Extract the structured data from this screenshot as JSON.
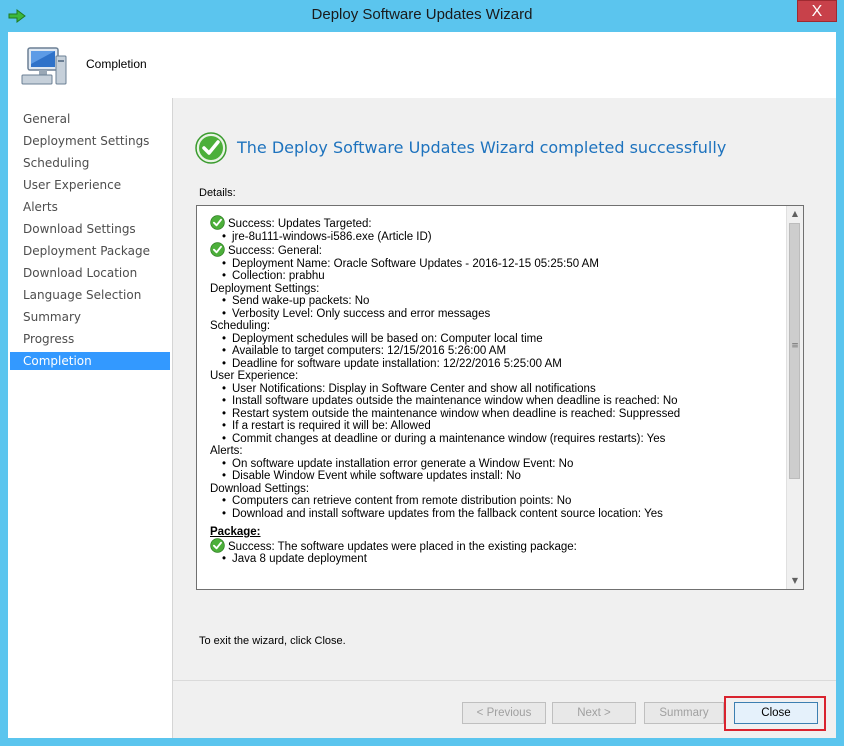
{
  "window": {
    "title": "Deploy Software Updates Wizard",
    "close_glyph": "X"
  },
  "header": {
    "title": "Completion"
  },
  "nav": {
    "items": [
      {
        "label": "General",
        "active": false
      },
      {
        "label": "Deployment Settings",
        "active": false
      },
      {
        "label": "Scheduling",
        "active": false
      },
      {
        "label": "User Experience",
        "active": false
      },
      {
        "label": "Alerts",
        "active": false
      },
      {
        "label": "Download Settings",
        "active": false
      },
      {
        "label": "Deployment Package",
        "active": false
      },
      {
        "label": "Download Location",
        "active": false
      },
      {
        "label": "Language Selection",
        "active": false
      },
      {
        "label": "Summary",
        "active": false
      },
      {
        "label": "Progress",
        "active": false
      },
      {
        "label": "Completion",
        "active": true
      }
    ]
  },
  "main": {
    "success_heading": "The Deploy Software Updates Wizard completed successfully",
    "details_label": "Details:",
    "details": [
      {
        "kind": "success",
        "text": "Success: Updates Targeted:"
      },
      {
        "kind": "bullet",
        "text": "jre-8u111-windows-i586.exe (Article ID)"
      },
      {
        "kind": "success",
        "text": "Success: General:"
      },
      {
        "kind": "bullet",
        "text": "Deployment Name: Oracle Software Updates - 2016-12-15 05:25:50 AM"
      },
      {
        "kind": "bullet",
        "text": "Collection: prabhu"
      },
      {
        "kind": "plain",
        "text": "Deployment Settings:"
      },
      {
        "kind": "bullet",
        "text": "Send wake-up packets: No"
      },
      {
        "kind": "bullet",
        "text": "Verbosity Level: Only success and error messages"
      },
      {
        "kind": "plain",
        "text": "Scheduling:"
      },
      {
        "kind": "bullet",
        "text": "Deployment schedules will be based on: Computer local time"
      },
      {
        "kind": "bullet",
        "text": "Available to target computers: 12/15/2016 5:26:00 AM"
      },
      {
        "kind": "bullet",
        "text": "Deadline for software update installation: 12/22/2016 5:25:00 AM"
      },
      {
        "kind": "plain",
        "text": "User Experience:"
      },
      {
        "kind": "bullet",
        "text": "User Notifications: Display in Software Center and show all notifications"
      },
      {
        "kind": "bullet",
        "text": "Install software updates outside the maintenance window when deadline is reached: No"
      },
      {
        "kind": "bullet",
        "text": "Restart system outside the maintenance window when deadline is reached: Suppressed"
      },
      {
        "kind": "bullet",
        "text": "If a restart is required it will be: Allowed"
      },
      {
        "kind": "bullet",
        "text": "Commit changes at deadline or during a maintenance window (requires restarts): Yes"
      },
      {
        "kind": "plain",
        "text": "Alerts:"
      },
      {
        "kind": "bullet",
        "text": "On software update installation error generate a Window Event: No"
      },
      {
        "kind": "bullet",
        "text": "Disable Window Event while software updates install: No"
      },
      {
        "kind": "plain",
        "text": "Download Settings:"
      },
      {
        "kind": "bullet",
        "text": "Computers can retrieve content from remote distribution points: No"
      },
      {
        "kind": "bullet",
        "text": "Download and install software updates from the fallback content source location: Yes"
      },
      {
        "kind": "pkg",
        "text": "Package:"
      },
      {
        "kind": "success",
        "text": "Success: The software updates were placed in the existing package:"
      },
      {
        "kind": "bullet",
        "text": "Java 8 update deployment"
      }
    ],
    "exit_text": "To exit the wizard, click Close."
  },
  "buttons": {
    "previous": "< Previous",
    "next": "Next >",
    "summary": "Summary",
    "close": "Close"
  },
  "colors": {
    "titlebar": "#5bc5ee",
    "nav_active": "#3399ff",
    "heading_blue": "#1e73be",
    "highlight_red": "#d9232e",
    "success_green": "#3a9b2e"
  }
}
